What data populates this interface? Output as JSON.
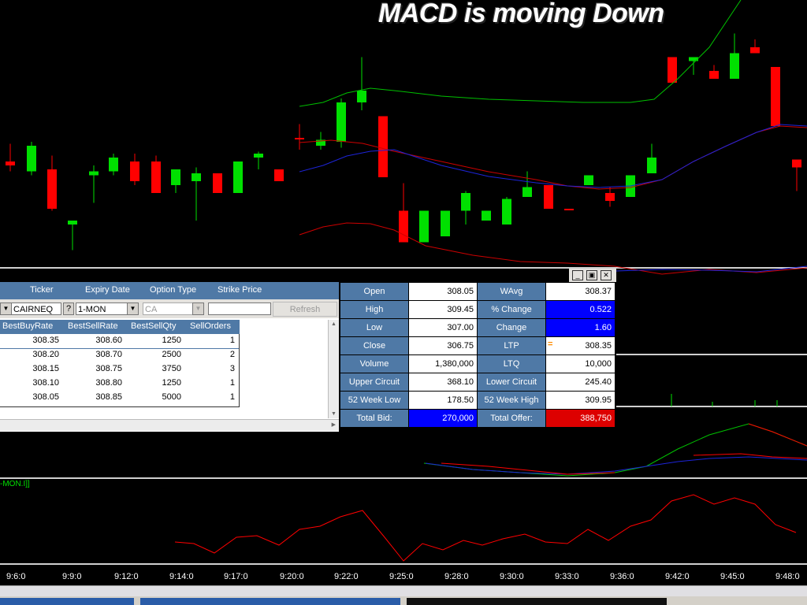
{
  "headline": "MACD is moving Down",
  "colors": {
    "up": "#00e000",
    "down": "#ff0000",
    "panel_blue": "#4f79a6",
    "highlight_blue": "#0000ff",
    "highlight_red": "#dd0000",
    "bollinger_mid": "#cc0000",
    "bollinger_band": "#1d24d8"
  },
  "depth": {
    "headers": {
      "ticker": "Ticker",
      "expiry": "Expiry Date",
      "option_type": "Option Type",
      "strike": "Strike Price"
    },
    "ticker_value": "CAIRNEQ",
    "help_button": "?",
    "expiry_value": "1-MON",
    "option_type_value": "CA",
    "strike_value": "",
    "refresh_label": "Refresh",
    "grid_headers": [
      "BestBuyRate",
      "BestSellRate",
      "BestSellQty",
      "SellOrders"
    ],
    "rows": [
      [
        "308.35",
        "308.60",
        "1250",
        "1"
      ],
      [
        "308.20",
        "308.70",
        "2500",
        "2"
      ],
      [
        "308.15",
        "308.75",
        "3750",
        "3"
      ],
      [
        "308.10",
        "308.80",
        "1250",
        "1"
      ],
      [
        "308.05",
        "308.85",
        "5000",
        "1"
      ]
    ]
  },
  "quote": {
    "rows": [
      {
        "l1": "Open",
        "v1": "308.05",
        "l2": "WAvg",
        "v2": "308.37"
      },
      {
        "l1": "High",
        "v1": "309.45",
        "l2": "% Change",
        "v2": "0.522"
      },
      {
        "l1": "Low",
        "v1": "307.00",
        "l2": "Change",
        "v2": "1.60"
      },
      {
        "l1": "Close",
        "v1": "306.75",
        "l2": "LTP",
        "v2": "308.35"
      },
      {
        "l1": "Volume",
        "v1": "1,380,000",
        "l2": "LTQ",
        "v2": "10,000"
      },
      {
        "l1": "Upper Circuit",
        "v1": "368.10",
        "l2": "Lower Circuit",
        "v2": "245.40"
      },
      {
        "l1": "52 Week Low",
        "v1": "178.50",
        "l2": "52 Week High",
        "v2": "309.95"
      },
      {
        "l1": "Total Bid:",
        "v1": "270,000",
        "l2": "Total Offer:",
        "v2": "388,750"
      }
    ],
    "ltp_marker": "="
  },
  "window_buttons": [
    "_",
    "▣",
    "✕"
  ],
  "macd_legend": "-MON.I]]",
  "time_axis": [
    "9:6:0",
    "9:9:0",
    "9:12:0",
    "9:14:0",
    "9:17:0",
    "9:20:0",
    "9:22:0",
    "9:25:0",
    "9:28:0",
    "9:30:0",
    "9:33:0",
    "9:36:0",
    "9:42:0",
    "9:45:0",
    "9:48:0"
  ],
  "candles": [
    {
      "d": "down",
      "o": 302,
      "c": 301.8,
      "h": 302.9,
      "l": 301.5
    },
    {
      "d": "up",
      "o": 301.5,
      "c": 302.8,
      "h": 303,
      "l": 301.3
    },
    {
      "d": "down",
      "o": 301.6,
      "c": 299.6,
      "h": 302.3,
      "l": 299.5
    },
    {
      "d": "up",
      "o": 298.8,
      "c": 299,
      "h": 299,
      "l": 297.5
    },
    {
      "d": "up",
      "o": 301.3,
      "c": 301.5,
      "h": 301.8,
      "l": 299.9
    },
    {
      "d": "up",
      "o": 301.5,
      "c": 302.2,
      "h": 302.4,
      "l": 301.3
    },
    {
      "d": "down",
      "o": 302,
      "c": 301,
      "h": 302.4,
      "l": 300.8
    },
    {
      "d": "down",
      "o": 302,
      "c": 300.4,
      "h": 302.3,
      "l": 300.4
    },
    {
      "d": "up",
      "o": 300.8,
      "c": 301.6,
      "h": 301.6,
      "l": 300.4
    },
    {
      "d": "up",
      "o": 301,
      "c": 301.4,
      "h": 301.7,
      "l": 299
    },
    {
      "d": "down",
      "o": 301.4,
      "c": 300.4,
      "h": 301.4,
      "l": 300.4
    },
    {
      "d": "up",
      "o": 300.4,
      "c": 302,
      "h": 302,
      "l": 300.4
    },
    {
      "d": "up",
      "o": 302.2,
      "c": 302.4,
      "h": 302.5,
      "l": 301.6
    },
    {
      "d": "down",
      "o": 301.6,
      "c": 301,
      "h": 301.6,
      "l": 301
    },
    {
      "d": "down",
      "o": 303.2,
      "c": 303.2,
      "h": 303.9,
      "l": 302.6
    },
    {
      "d": "up",
      "o": 302.8,
      "c": 303.1,
      "h": 303.5,
      "l": 302.6
    },
    {
      "d": "up",
      "o": 303,
      "c": 305,
      "h": 305.2,
      "l": 302.7
    },
    {
      "d": "up",
      "o": 305,
      "c": 305.6,
      "h": 307.3,
      "l": 304.6
    },
    {
      "d": "down",
      "o": 304.3,
      "c": 301.2,
      "h": 304.3,
      "l": 301.2
    },
    {
      "d": "down",
      "o": 299.5,
      "c": 297.9,
      "h": 300.9,
      "l": 297.9
    },
    {
      "d": "up",
      "o": 297.9,
      "c": 299.5,
      "h": 299.5,
      "l": 297.9
    },
    {
      "d": "up",
      "o": 298.2,
      "c": 299.5,
      "h": 299.5,
      "l": 298.2
    },
    {
      "d": "up",
      "o": 299.5,
      "c": 300.4,
      "h": 300.5,
      "l": 298.8
    },
    {
      "d": "up",
      "o": 299,
      "c": 299.5,
      "h": 299.5,
      "l": 299
    },
    {
      "d": "up",
      "o": 298.8,
      "c": 300.1,
      "h": 300.2,
      "l": 298.8
    },
    {
      "d": "up",
      "o": 300.2,
      "c": 300.7,
      "h": 301.5,
      "l": 300.2
    },
    {
      "d": "down",
      "o": 300.8,
      "c": 299.6,
      "h": 300.8,
      "l": 299.6
    },
    {
      "d": "down",
      "o": 299.6,
      "c": 299.6,
      "h": 299.6,
      "l": 299.6
    },
    {
      "d": "up",
      "o": 300.8,
      "c": 301.3,
      "h": 301.3,
      "l": 300.8
    },
    {
      "d": "down",
      "o": 300.4,
      "c": 300,
      "h": 300.7,
      "l": 299.7
    },
    {
      "d": "up",
      "o": 300.2,
      "c": 301.3,
      "h": 301.3,
      "l": 300.2
    },
    {
      "d": "up",
      "o": 301.4,
      "c": 302.2,
      "h": 302.9,
      "l": 301.4
    },
    {
      "d": "down",
      "o": 307.3,
      "c": 306,
      "h": 307.3,
      "l": 306
    },
    {
      "d": "up",
      "o": 307.1,
      "c": 307.3,
      "h": 307.3,
      "l": 306.4
    },
    {
      "d": "down",
      "o": 306.6,
      "c": 306.2,
      "h": 306.9,
      "l": 306.2
    },
    {
      "d": "up",
      "o": 306.2,
      "c": 307.5,
      "h": 308.5,
      "l": 306.2
    },
    {
      "d": "down",
      "o": 307.8,
      "c": 307.5,
      "h": 308.2,
      "l": 307.5
    },
    {
      "d": "down",
      "o": 306.8,
      "c": 303.8,
      "h": 306.8,
      "l": 303.8
    },
    {
      "d": "down",
      "o": 302.1,
      "c": 301.7,
      "h": 302.1,
      "l": 300.5
    }
  ]
}
